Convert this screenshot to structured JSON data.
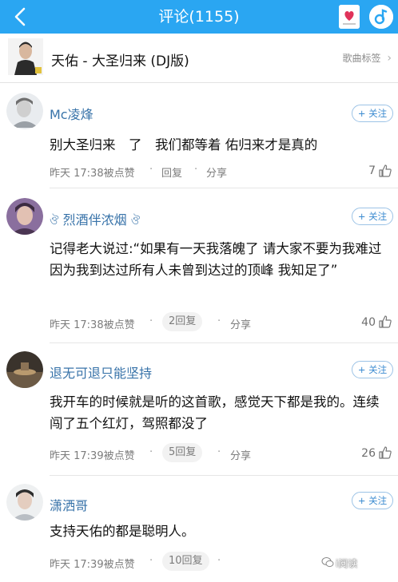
{
  "navbar": {
    "title": "评论(1155)",
    "back_icon": "back-arrow-icon",
    "card_icon": "music-card-icon",
    "music_icon": "music-note-icon",
    "bg_color": "#2aa6f2"
  },
  "song": {
    "title": "天佑 - 大圣归来 (DJ版)",
    "tag_label": "歌曲标签",
    "chevron": "›"
  },
  "comments": [
    {
      "username": "Mc凌烽",
      "follow_label": "+ 关注",
      "content": "别大圣归来　了　我们都等着 佑归来才是真的",
      "time": "昨天 17:38被点赞",
      "reply": "回复",
      "share": "分享",
      "likes": "7"
    },
    {
      "username": "烈酒伴浓烟",
      "follow_label": "+ 关注",
      "content": "记得老大说过:“如果有一天我落魄了 请大家不要为我难过 因为我到达过所有人未曾到达过的顶峰 我知足了”",
      "time": "昨天 17:38被点赞",
      "reply": "2回复",
      "share": "分享",
      "likes": "40"
    },
    {
      "username": "退无可退只能坚持",
      "follow_label": "+ 关注",
      "content": "我开车的时候就是听的这首歌，感觉天下都是我的。连续闯了五个红灯，驾照都没了",
      "time": "昨天 17:39被点赞",
      "reply": "5回复",
      "share": "分享",
      "likes": "26"
    },
    {
      "username": "潇洒哥",
      "follow_label": "+ 关注",
      "content": "支持天佑的都是聪明人。",
      "time": "昨天 17:39被点赞",
      "reply": "10回复",
      "share": "",
      "likes": ""
    }
  ],
  "watermark": "i阅读"
}
